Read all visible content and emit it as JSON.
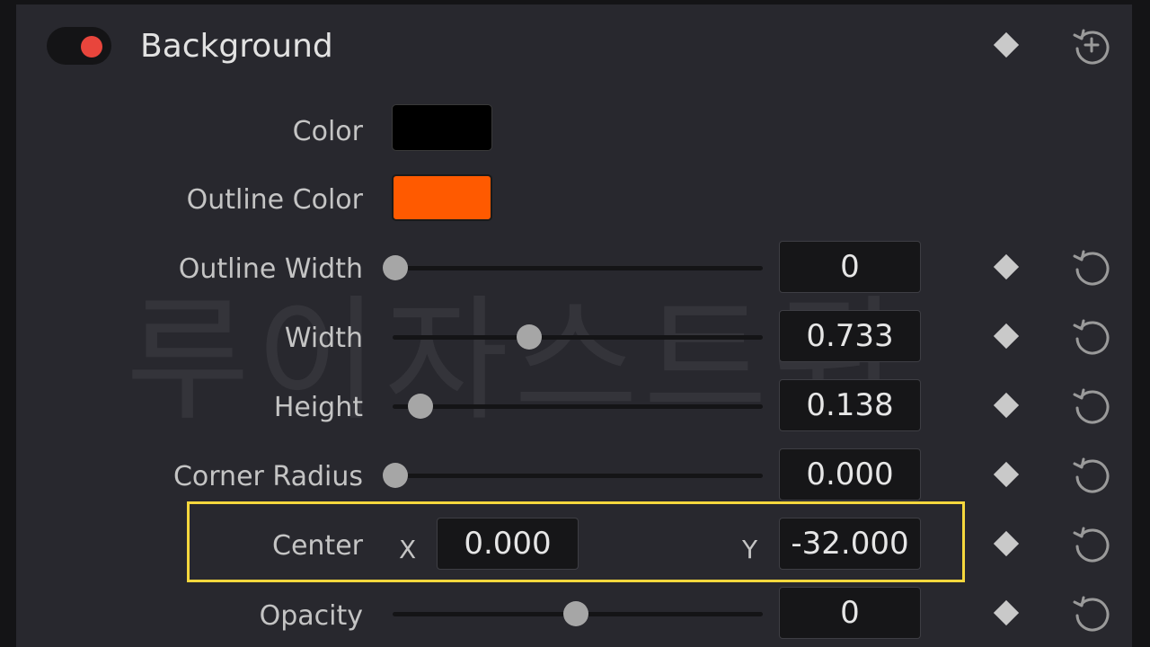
{
  "section": {
    "title": "Background",
    "enabled": true
  },
  "rows": {
    "color": {
      "label": "Color",
      "swatch": "#000000"
    },
    "outline_color": {
      "label": "Outline Color",
      "swatch": "#ff5a00"
    },
    "outline_width": {
      "label": "Outline Width",
      "value": "0",
      "slider_fraction": 0.0
    },
    "width": {
      "label": "Width",
      "value": "0.733",
      "slider_fraction": 0.37
    },
    "height": {
      "label": "Height",
      "value": "0.138",
      "slider_fraction": 0.07
    },
    "corner_radius": {
      "label": "Corner Radius",
      "value": "0.000",
      "slider_fraction": 0.0
    },
    "center": {
      "label": "Center",
      "x_label": "X",
      "x_value": "0.000",
      "y_label": "Y",
      "y_value": "-32.000"
    },
    "opacity": {
      "label": "Opacity",
      "value": "0",
      "slider_fraction": 0.5
    }
  },
  "watermark": "루이자스트뭐",
  "icons": {
    "keyframe": "keyframe-diamond-icon",
    "reset": "reset-icon",
    "reset_add": "reset-add-icon"
  },
  "colors": {
    "highlight": "#f5d73d",
    "toggle_on": "#e8453c"
  }
}
